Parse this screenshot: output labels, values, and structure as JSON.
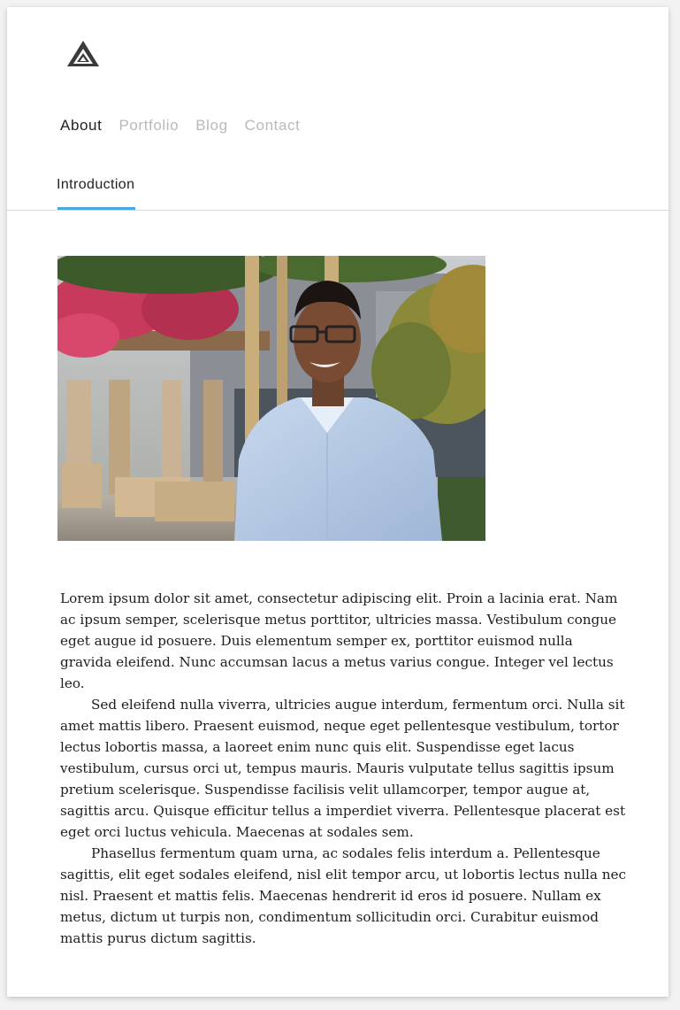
{
  "logo": {
    "icon": "triangle-logo-icon"
  },
  "nav": {
    "items": [
      {
        "label": "About",
        "active": true
      },
      {
        "label": "Portfolio",
        "active": false
      },
      {
        "label": "Blog",
        "active": false
      },
      {
        "label": "Contact",
        "active": false
      }
    ]
  },
  "tabs": {
    "active_label": "Introduction",
    "accent_color": "#4aa8e0"
  },
  "photo": {
    "subject": "profile-photo"
  },
  "content": {
    "paragraphs": [
      "Lorem ipsum dolor sit amet, consectetur adipiscing elit. Proin a lacinia erat. Nam ac ipsum semper, scelerisque metus porttitor, ultricies massa. Vestibulum congue eget augue id posuere. Duis elementum semper ex, porttitor euismod nulla gravida eleifend. Nunc accumsan lacus a metus varius congue. Integer vel lectus leo.",
      "Sed eleifend nulla viverra, ultricies augue interdum, fermentum orci. Nulla sit amet mattis libero. Praesent euismod, neque eget pellentesque vestibulum, tortor lectus lobortis massa, a laoreet enim nunc quis elit. Suspendisse eget lacus vestibulum, cursus orci ut, tempus mauris. Mauris vulputate tellus sagittis ipsum pretium scelerisque. Suspendisse facilisis velit ullamcorper, tempor augue at, sagittis arcu. Quisque efficitur tellus a imperdiet viverra. Pellentesque placerat est eget orci luctus vehicula. Maecenas at sodales sem.",
      "Phasellus fermentum quam urna, ac sodales felis interdum a. Pellentesque sagittis, elit eget sodales eleifend, nisl elit tempor arcu, ut lobortis lectus nulla nec nisl. Praesent et mattis felis. Maecenas hendrerit id eros id posuere. Nullam ex metus, dictum ut turpis non, condimentum sollicitudin orci. Curabitur euismod mattis purus dictum sagittis."
    ]
  }
}
